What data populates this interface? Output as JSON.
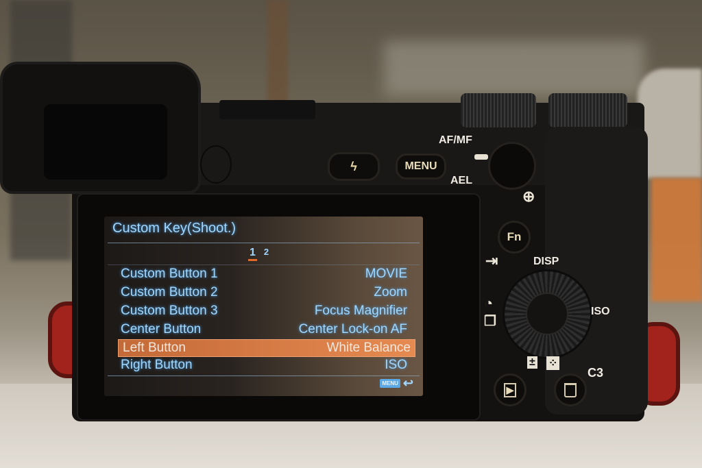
{
  "camera": {
    "buttons": {
      "flash": {
        "icon": "flash-icon",
        "glyph": "ϟ"
      },
      "menu": {
        "label": "MENU"
      },
      "fn": {
        "label": "Fn"
      },
      "playback": {
        "icon": "playback-icon",
        "glyph": "▶"
      },
      "trash": {
        "icon": "trash-icon",
        "glyph": "🗑"
      }
    },
    "labels": {
      "af_mf": "AF/MF",
      "ael": "AEL",
      "disp": "DISP",
      "iso": "ISO",
      "c3": "C3",
      "zoom_glyph": "⊕",
      "send_glyph": "⇥",
      "timer_glyph": "◔",
      "drive_glyph": "❐",
      "exposure_glyph": "±",
      "focus_glyph": "⁘"
    }
  },
  "screen": {
    "title": "Custom Key(Shoot.)",
    "pages": [
      {
        "label": "1",
        "active": true
      },
      {
        "label": "2",
        "active": false
      }
    ],
    "rows": [
      {
        "label": "Custom Button 1",
        "value": "MOVIE",
        "selected": false
      },
      {
        "label": "Custom Button 2",
        "value": "Zoom",
        "selected": false
      },
      {
        "label": "Custom Button 3",
        "value": "Focus Magnifier",
        "selected": false
      },
      {
        "label": "Center Button",
        "value": "Center Lock-on AF",
        "selected": false
      },
      {
        "label": "Left Button",
        "value": "White Balance",
        "selected": true
      },
      {
        "label": "Right Button",
        "value": "ISO",
        "selected": false
      }
    ],
    "footer": {
      "menu_chip": "MENU",
      "back_glyph": "↩"
    },
    "colors": {
      "text": "#9fd7ff",
      "highlight": "#d9783f"
    }
  }
}
